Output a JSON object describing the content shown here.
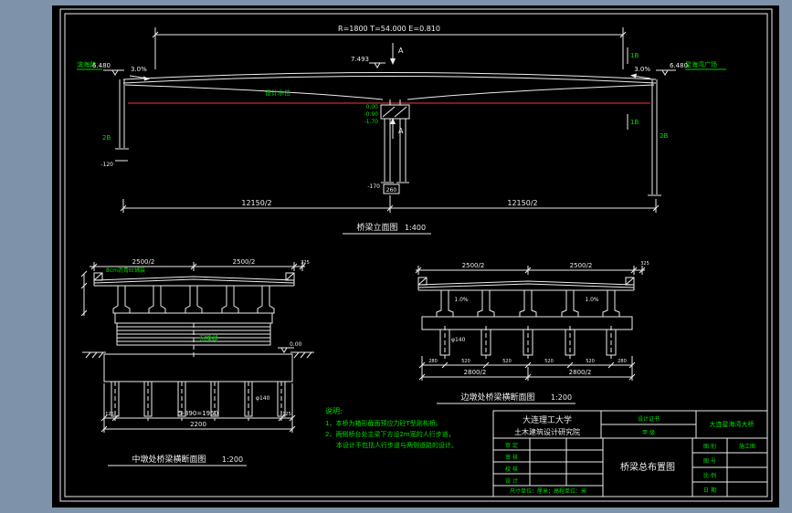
{
  "app": {
    "background": "#7e93aa",
    "canvas_bg": "#000000",
    "line_color": "#ededed",
    "label_color": "#00dd00",
    "water_line_color": "#ff3333"
  },
  "elevation": {
    "curve_params": "R=1800   T=54.000   E=0.810",
    "left_road": "滨海路",
    "right_road": "星海湾广场",
    "left_elev": "6.480",
    "right_elev": "6.480",
    "left_slope": "3.0%",
    "right_slope": "3.0%",
    "center_elev": "7.493",
    "section_a_top": "A",
    "section_a_bottom": "A",
    "section_1b_top": "1B",
    "section_1b_mid": "1B",
    "section_2b_left": "2B",
    "section_2b_right": "2B",
    "water_label": "设计水位",
    "pier_elev_1": "0.00",
    "pier_elev_2": "-0.90",
    "pier_elev_3": "-1.70",
    "pile_tip": "-170",
    "pile_box": "260",
    "abut_tip": "-120",
    "dim_left": "12150/2",
    "dim_right": "12150/2",
    "title": "桥梁立面图",
    "scale": "1:400"
  },
  "mid_section": {
    "dim_top_left": "2500/2",
    "dim_top_right": "2500/2",
    "dim_top_edge": "325",
    "pave_note": "8cm沥青砼铺装",
    "joint_label": "沉降缝",
    "zero_elev": "0.00",
    "pile_dia": "φ140",
    "dim_edge_left": "125",
    "dim_piles": "5-390=1950",
    "dim_edge_right": "125",
    "dim_total": "2200",
    "title": "中墩处桥梁横断面图",
    "scale": "1:200"
  },
  "side_section": {
    "dim_top_left": "2500/2",
    "dim_top_right": "2500/2",
    "dim_top_edge": "325",
    "slope_left": "1.0%",
    "slope_right": "1.0%",
    "pile_dia": "φ140",
    "dims_bottom": [
      "280",
      "520",
      "520",
      "520",
      "520",
      "280"
    ],
    "dim_total_left": "2800/2",
    "dim_total_right": "2800/2",
    "title": "边墩处桥梁横断面图",
    "scale": "1:200"
  },
  "notes": {
    "heading": "说明:",
    "line1": "1、本桥为箱形截面预应力砼T型刚构桥。",
    "line2": "2、两侧桥台处主梁下方设2m宽的人行步道，",
    "line3": "本设计不包括人行步道与两侧道路的设计。"
  },
  "titleblock": {
    "org_line1": "大连理工大学",
    "org_line2": "土木建筑设计研究院",
    "cert_label": "设计证书",
    "cert_value": "甲 级",
    "project": "大连星海湾大桥",
    "drawing_title": "桥梁总布置图",
    "roles": [
      "审 定",
      "审 核",
      "校 核",
      "设 计"
    ],
    "col_labels": [
      "图 别",
      "图 号",
      "比 例",
      "日 期"
    ],
    "doc_type": "施工图",
    "note": "尺寸单位：厘米；高程单位：米"
  }
}
